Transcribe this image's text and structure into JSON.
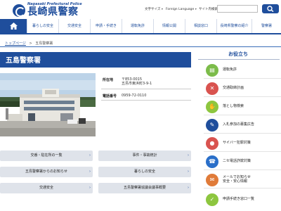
{
  "header": {
    "logo_sub": "Nagasaki Prefectural Police",
    "logo_main": "長崎県警察",
    "font_size_label": "文字サイズ",
    "language_label": "Foreign Language",
    "search_label": "サイト内検索",
    "search_placeholder": ""
  },
  "nav": {
    "items": [
      {
        "label": "暮らしの安全"
      },
      {
        "label": "交通安全"
      },
      {
        "label": "申請・手続き"
      },
      {
        "label": "運転免許"
      },
      {
        "label": "情報公開"
      },
      {
        "label": "相談窓口"
      },
      {
        "label": "長崎県警察の紹介"
      },
      {
        "label": "警察署"
      }
    ]
  },
  "breadcrumb": {
    "home": "トップページ",
    "separator": ">",
    "current": "五島警察署"
  },
  "page": {
    "title": "五島警察署"
  },
  "info": {
    "address_label": "所在地",
    "address_line1": "〒853-0015",
    "address_line2": "五島市東浜町3-9-1",
    "phone_label": "電話番号",
    "phone": "0959-72-0110"
  },
  "links": [
    {
      "label": "交番・駐在所の一覧"
    },
    {
      "label": "事件・事故統計"
    },
    {
      "label": "五島警察署からのお知らせ"
    },
    {
      "label": "暮らしの安全"
    },
    {
      "label": "交通安全"
    },
    {
      "label": "五島警察署協議会議事概要"
    }
  ],
  "sidebar": {
    "title": "お役立ち",
    "items": [
      {
        "label": "運転免許",
        "color": "#7cbc4a",
        "icon": "license-icon"
      },
      {
        "label": "交通取締計画",
        "color": "#d9534f",
        "icon": "traffic-control-icon"
      },
      {
        "label": "落とし物検索",
        "color": "#8dc63f",
        "icon": "lost-item-icon"
      },
      {
        "label": "入札参加の募集広告",
        "color": "#1f4e9c",
        "icon": "bid-icon"
      },
      {
        "label": "サイバー犯罪対策",
        "color": "#d9534f",
        "icon": "cyber-icon"
      },
      {
        "label": "ニセ電話詐欺対策",
        "color": "#2a6fc9",
        "icon": "phone-fraud-icon"
      },
      {
        "label_line1": "メールでお知らせ",
        "label_line2": "安全・安心情報",
        "color": "#e07b39",
        "icon": "mail-icon"
      },
      {
        "label": "申請手続き窓口一覧",
        "color": "#8dc63f",
        "icon": "application-icon"
      }
    ]
  },
  "colors": {
    "brand": "#1f4e9c",
    "button_bg": "#dfe3ea"
  }
}
